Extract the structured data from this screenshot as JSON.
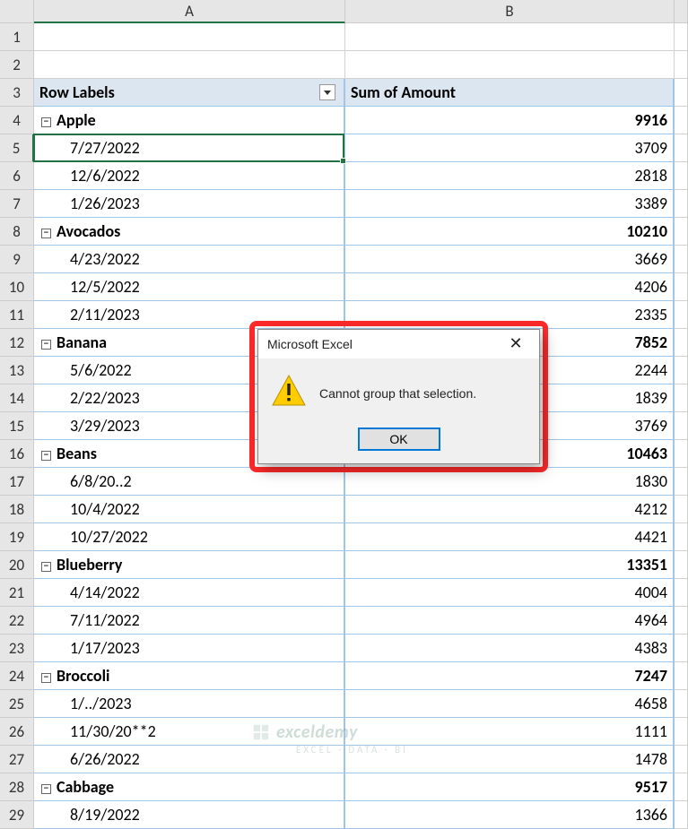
{
  "columns": [
    "A",
    "B"
  ],
  "rowCount": 29,
  "pivot": {
    "headers": {
      "rowLabels": "Row Labels",
      "sum": "Sum of Amount"
    },
    "groups": [
      {
        "label": "Apple",
        "total": 9916,
        "items": [
          {
            "date": "7/27/2022",
            "value": 3709
          },
          {
            "date": "12/6/2022",
            "value": 2818
          },
          {
            "date": "1/26/2023",
            "value": 3389
          }
        ]
      },
      {
        "label": "Avocados",
        "total": 10210,
        "items": [
          {
            "date": "4/23/2022",
            "value": 3669
          },
          {
            "date": "12/5/2022",
            "value": 4206
          },
          {
            "date": "2/11/2023",
            "value": 2335
          }
        ]
      },
      {
        "label": "Banana",
        "total": 7852,
        "items": [
          {
            "date": "5/6/2022",
            "value": 2244
          },
          {
            "date": "2/22/2023",
            "value": 1839
          },
          {
            "date": "3/29/2023",
            "value": 3769
          }
        ]
      },
      {
        "label": "Beans",
        "total": 10463,
        "items": [
          {
            "date": "6/8/20..2",
            "value": 1830
          },
          {
            "date": "10/4/2022",
            "value": 4212
          },
          {
            "date": "10/27/2022",
            "value": 4421
          }
        ]
      },
      {
        "label": "Blueberry",
        "total": 13351,
        "items": [
          {
            "date": "4/14/2022",
            "value": 4004
          },
          {
            "date": "7/11/2022",
            "value": 4964
          },
          {
            "date": "1/17/2023",
            "value": 4383
          }
        ]
      },
      {
        "label": "Broccoli",
        "total": 7247,
        "items": [
          {
            "date": "1/../2023",
            "value": 4658
          },
          {
            "date": "11/30/20**2",
            "value": 1111
          },
          {
            "date": "6/26/2022",
            "value": 1478
          }
        ]
      },
      {
        "label": "Cabbage",
        "total": 9517,
        "items": [
          {
            "date": "8/19/2022",
            "value": 1366
          }
        ]
      }
    ]
  },
  "selectedCell": {
    "row": 5,
    "col": "A"
  },
  "dialog": {
    "title": "Microsoft Excel",
    "message": "Cannot group that selection.",
    "okLabel": "OK"
  },
  "watermark": {
    "text": "exceldemy",
    "sub": "EXCEL · DATA · BI"
  }
}
